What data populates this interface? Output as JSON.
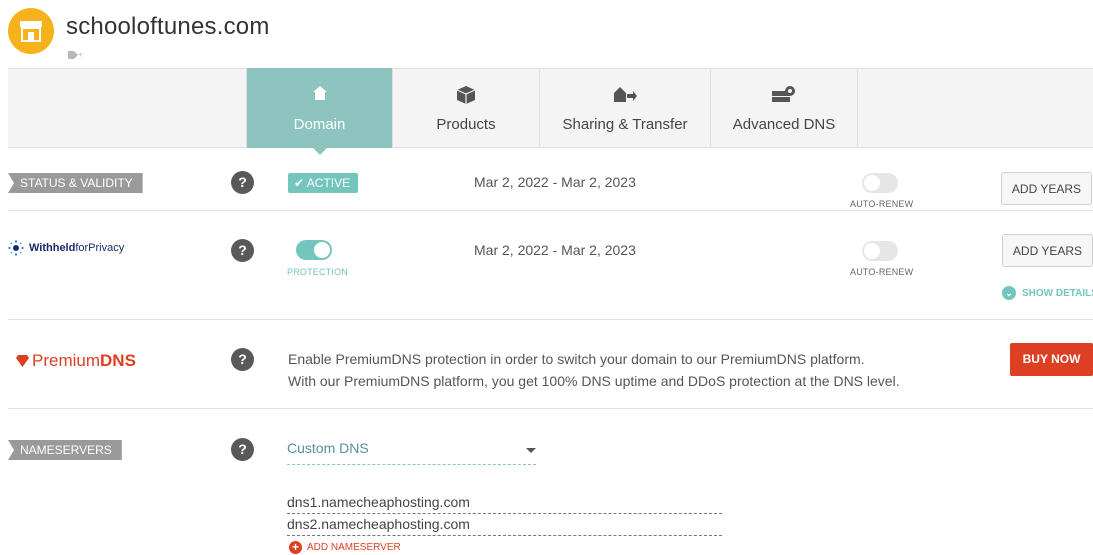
{
  "header": {
    "domain": "schooloftunes.com",
    "tag_icon": "tag-plus-icon",
    "logo_icon": "storefront-icon",
    "brand_color": "#f5b21b"
  },
  "tabs": [
    {
      "label": "Domain",
      "icon": "home-icon",
      "active": true
    },
    {
      "label": "Products",
      "icon": "box-icon",
      "active": false
    },
    {
      "label": "Sharing & Transfer",
      "icon": "share-arrow-icon",
      "active": false
    },
    {
      "label": "Advanced DNS",
      "icon": "server-gear-icon",
      "active": false
    }
  ],
  "status_row": {
    "label": "STATUS & VALIDITY",
    "help": "?",
    "badge": "ACTIVE",
    "dates": "Mar 2, 2022 - Mar 2, 2023",
    "auto_renew_label": "AUTO-RENEW",
    "auto_renew_on": false,
    "button": "ADD YEARS"
  },
  "privacy_row": {
    "brand_prefix": "Withheld",
    "brand_suffix": "forPrivacy",
    "help": "?",
    "protection_label": "PROTECTION",
    "protection_on": true,
    "dates": "Mar 2, 2022 - Mar 2, 2023",
    "auto_renew_label": "AUTO-RENEW",
    "auto_renew_on": false,
    "button": "ADD YEARS",
    "show_details": "SHOW DETAILS"
  },
  "premium_row": {
    "brand_prefix": "Premium",
    "brand_suffix": "DNS",
    "help": "?",
    "line1": "Enable PremiumDNS protection in order to switch your domain to our PremiumDNS platform.",
    "line2": "With our PremiumDNS platform, you get 100% DNS uptime and DDoS protection at the DNS level.",
    "button": "BUY NOW",
    "accent": "#dc3f22"
  },
  "nameservers_row": {
    "label": "NAMESERVERS",
    "help": "?",
    "selected": "Custom DNS",
    "ns1": "dns1.namecheaphosting.com",
    "ns2": "dns2.namecheaphosting.com",
    "add_label": "ADD NAMESERVER"
  },
  "colors": {
    "teal": "#8dc4c0",
    "toggle_on": "#74c5be",
    "ribbon": "#9a9a9a"
  }
}
